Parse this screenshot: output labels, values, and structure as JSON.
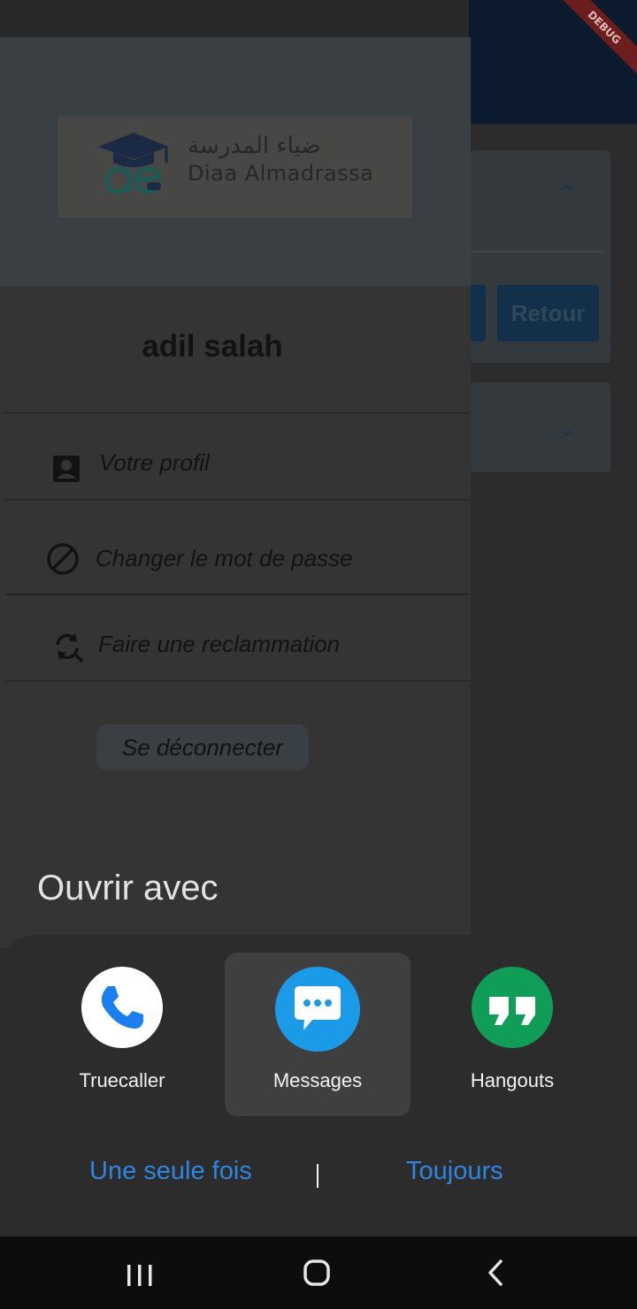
{
  "debug_banner": "DEBUG",
  "background_app": {
    "retour_label": "Retour",
    "chevron_up": "⌃",
    "chevron_down": "⌄"
  },
  "drawer": {
    "logo": {
      "arabic_text": "ضياء المدرسة",
      "latin_text": "Diaa Almadrassa"
    },
    "user_name": "adil salah",
    "menu": [
      {
        "label": "Votre profil",
        "icon": "account-box-icon"
      },
      {
        "label": "Changer le mot de passe",
        "icon": "block-icon"
      },
      {
        "label": "Faire une reclammation",
        "icon": "search-refresh-icon"
      }
    ],
    "logout_label": "Se déconnecter"
  },
  "chooser": {
    "title": "Ouvrir avec",
    "apps": [
      {
        "label": "Truecaller",
        "icon": "phone-icon",
        "selected": false
      },
      {
        "label": "Messages",
        "icon": "message-bubble-icon",
        "selected": true
      },
      {
        "label": "Hangouts",
        "icon": "quote-icon",
        "selected": false
      }
    ],
    "once_label": "Une seule fois",
    "always_label": "Toujours"
  },
  "colors": {
    "accent": "#2f86e0",
    "truecaller": "#ffffff",
    "messages": "#1b9ae8",
    "hangouts": "#0f9d58"
  }
}
